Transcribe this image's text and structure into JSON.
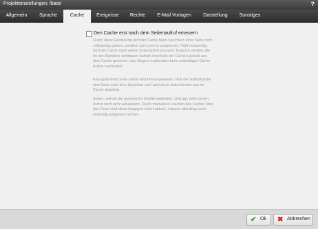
{
  "window": {
    "title": "Projekteinstellungen: /base",
    "help": "?"
  },
  "tabs": [
    {
      "label": "Allgemein"
    },
    {
      "label": "Sprache"
    },
    {
      "label": "Cache"
    },
    {
      "label": "Ereignisse"
    },
    {
      "label": "Rechte"
    },
    {
      "label": "E-Mail Vorlagen"
    },
    {
      "label": "Darstellung"
    },
    {
      "label": "Sonstiges"
    }
  ],
  "active_tab": "Cache",
  "cache": {
    "checkbox_label": "Den Cache erst nach dem Seitenaufruf erneuern",
    "checked": false,
    "paragraphs": [
      [
        "Durch diese Einstellung wird der Cache beim Speichern einer Seite nicht",
        "vollständig geleert, sondern zum Leeren vorgemerkt. Falls notwendig,",
        "wird der Cache nach einem Seitenaufruf erneuert. Dadurch werden alle",
        "für den Benutzer sichtbaren Aufrufe innerhalb der Cache-Laufzeit aus",
        "dem Cache generiert, was längere Ladezeiten beim erstmaligen Cache-",
        "Aufbau verhindert."
      ],
      [
        "Eine geänderte Seite selbst wird erneut generiert. Ruft die Volltextsuche",
        "eine Seite nach dem Speichern auf, wird diese dabei bereits neu im",
        "Cache abgelegt."
      ],
      [
        "Seiten, welche die geänderten Inhalte einbinden, sind ggf. beim ersten",
        "Aufruf noch nicht aktualisiert. Durch manuelles Löschen des Caches über",
        "das Panel sind diese hingegen sofort aktuell, müssen allerdings auch",
        "erstmalig aufgebaut werden."
      ]
    ]
  },
  "footer": {
    "ok_label": "Ok",
    "cancel_label": "Abbrechen"
  },
  "colors": {
    "ok_check": "#3a9a2a",
    "cancel_x": "#cc2222"
  }
}
